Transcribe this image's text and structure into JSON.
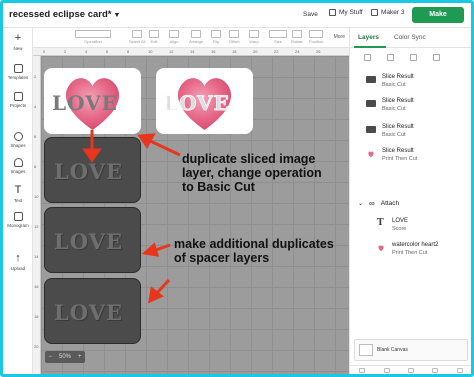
{
  "header": {
    "title": "recessed eclipse card*",
    "save_label": "Save",
    "my_stuff_label": "My Stuff",
    "maker_label": "Maker 3",
    "make_label": "Make"
  },
  "toolbar": {
    "tools": [
      "Operation",
      "Select All",
      "Edit",
      "Align",
      "Arrange",
      "Flip",
      "Offset",
      "Warp",
      "Size",
      "Rotate",
      "Position"
    ],
    "more_label": "More"
  },
  "leftnav": {
    "items": [
      {
        "label": "New",
        "icon": "plus-icon"
      },
      {
        "label": "Templates",
        "icon": "shirt-icon"
      },
      {
        "label": "Projects",
        "icon": "folder-icon"
      },
      {
        "label": "Shapes",
        "icon": "shapes-icon"
      },
      {
        "label": "Images",
        "icon": "lightbulb-icon"
      },
      {
        "label": "Text",
        "icon": "text-icon"
      },
      {
        "label": "Monogram",
        "icon": "monogram-icon"
      },
      {
        "label": "Upload",
        "icon": "upload-icon"
      }
    ]
  },
  "canvas": {
    "love_text": "LOVE",
    "zoom_label": "50%",
    "ruler_top": [
      "0",
      "2",
      "4",
      "6",
      "8",
      "10",
      "12",
      "14",
      "16",
      "18",
      "20",
      "22",
      "24",
      "26"
    ],
    "ruler_left": [
      "2",
      "4",
      "6",
      "8",
      "10",
      "12",
      "14",
      "16",
      "18",
      "20"
    ]
  },
  "annotations": {
    "note1": [
      "duplicate sliced image",
      "layer, change operation",
      "to Basic Cut"
    ],
    "note2": [
      "make additional duplicates",
      "of spacer layers"
    ]
  },
  "panel": {
    "tabs": [
      "Layers",
      "Color Sync"
    ],
    "layers": [
      {
        "name": "Slice Result",
        "op": "Basic Cut",
        "thumb": "dark"
      },
      {
        "name": "Slice Result",
        "op": "Basic Cut",
        "thumb": "dark"
      },
      {
        "name": "Slice Result",
        "op": "Basic Cut",
        "thumb": "dark"
      },
      {
        "name": "Slice Result",
        "op": "Print Then Cut",
        "thumb": "heart"
      }
    ],
    "group_label": "Attach",
    "group_children": [
      {
        "name": "LOVE",
        "op": "Score",
        "thumb": "text"
      },
      {
        "name": "watercolor heart2",
        "op": "Print Then Cut",
        "thumb": "heart"
      }
    ],
    "blank_canvas_label": "Blank Canvas"
  },
  "colors": {
    "accent": "#1f9a52",
    "frame": "#19c8e3",
    "arrow": "#e8361c",
    "heart": "#e76a8a"
  }
}
